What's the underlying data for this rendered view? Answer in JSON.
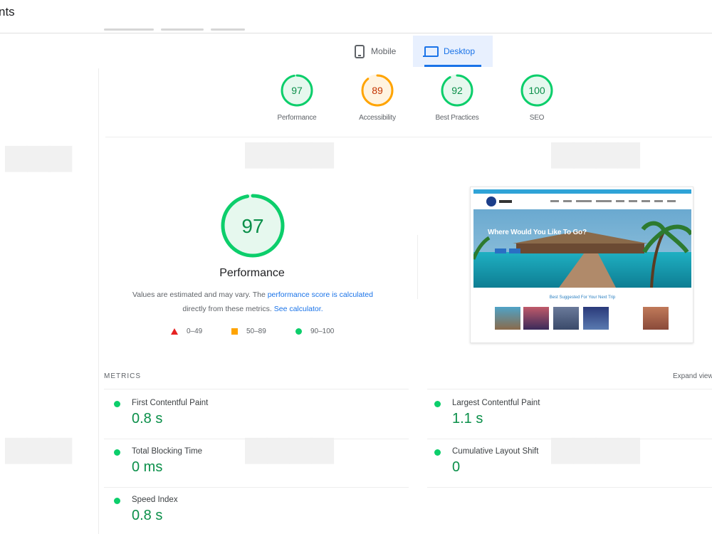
{
  "header": {
    "title": "nts"
  },
  "tabs": [
    {
      "label": "Mobile",
      "active": false,
      "icon": "phone-icon"
    },
    {
      "label": "Desktop",
      "active": true,
      "icon": "laptop-icon"
    }
  ],
  "categories": [
    {
      "score": "97",
      "label": "Performance",
      "status": "pass",
      "fraction": 0.97
    },
    {
      "score": "89",
      "label": "Accessibility",
      "status": "average",
      "fraction": 0.89
    },
    {
      "score": "92",
      "label": "Best Practices",
      "status": "pass",
      "fraction": 0.92
    },
    {
      "score": "100",
      "label": "SEO",
      "status": "pass",
      "fraction": 1.0
    }
  ],
  "performance": {
    "score": "97",
    "fraction": 0.97,
    "title": "Performance",
    "desc_part1": "Values are estimated and may vary. The ",
    "desc_link1": "performance score is calculated",
    "desc_part2": " directly from these metrics. ",
    "desc_link2": "See calculator.",
    "legend": [
      {
        "shape": "triangle",
        "range": "0–49",
        "color": "#e52222"
      },
      {
        "shape": "square",
        "range": "50–89",
        "color": "#ffa400"
      },
      {
        "shape": "circle",
        "range": "90–100",
        "color": "#0cce6b"
      }
    ]
  },
  "screenshot": {
    "hero_heading": "Where Would You Like To Go?",
    "subheading": "Best Suggested For Your Next Trip"
  },
  "metrics": {
    "header": "METRICS",
    "expand_label": "Expand view",
    "items": [
      {
        "label": "First Contentful Paint",
        "value": "0.8 s",
        "status": "pass"
      },
      {
        "label": "Largest Contentful Paint",
        "value": "1.1 s",
        "status": "pass"
      },
      {
        "label": "Total Blocking Time",
        "value": "0 ms",
        "status": "pass"
      },
      {
        "label": "Cumulative Layout Shift",
        "value": "0",
        "status": "pass"
      },
      {
        "label": "Speed Index",
        "value": "0.8 s",
        "status": "pass"
      }
    ]
  },
  "colors": {
    "pass": "#0cce6b",
    "pass_text": "#0a8f49",
    "pass_bg": "#e6f8ee",
    "average": "#ffa400",
    "average_text": "#c33300",
    "average_bg": "#fff3e0",
    "accent": "#1a73e8"
  }
}
